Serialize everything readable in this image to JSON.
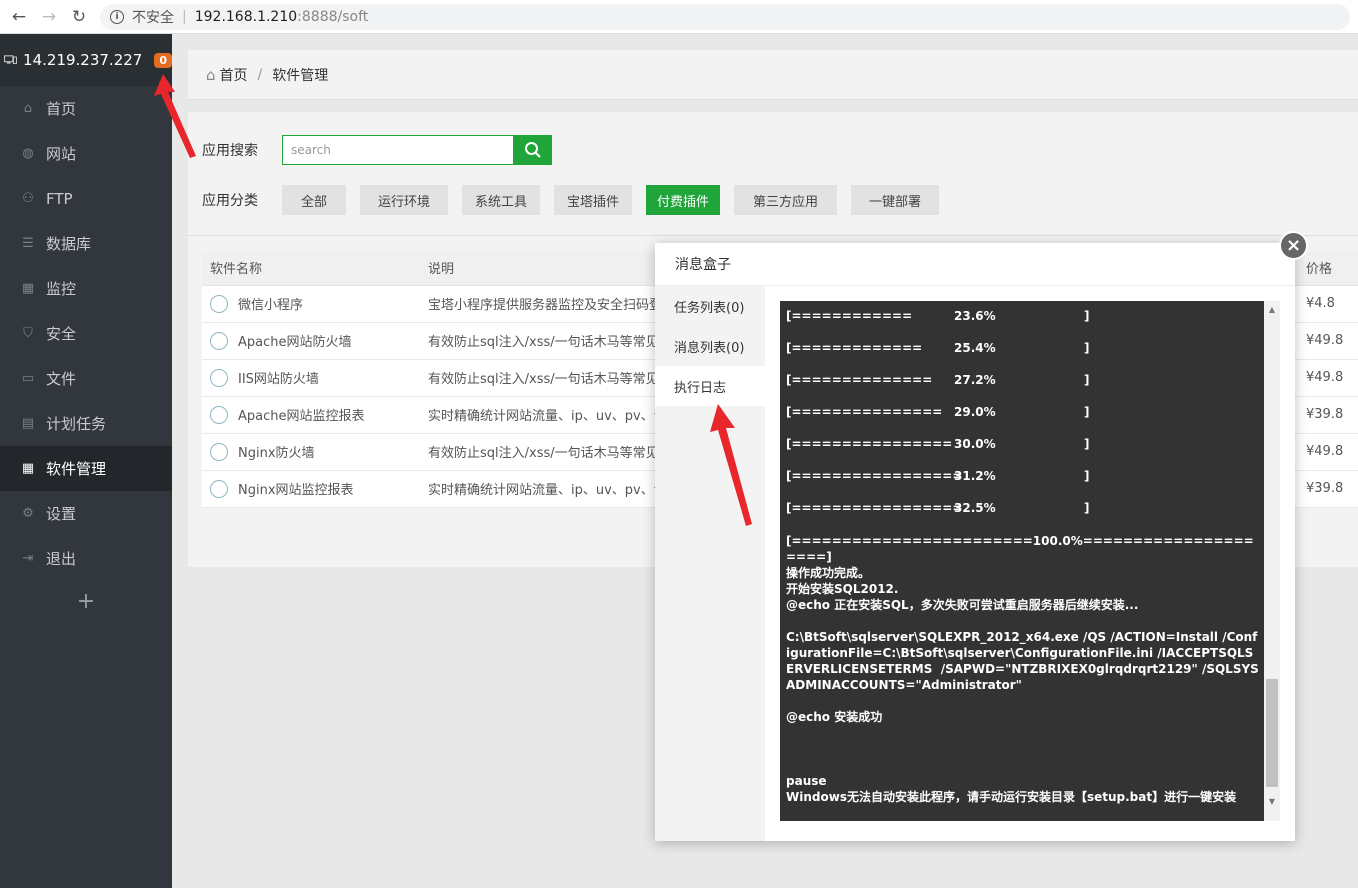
{
  "browser": {
    "insecure_label": "不安全",
    "url_host": "192.168.1.210",
    "url_path": ":8888/soft"
  },
  "sidebar": {
    "server_ip": "14.219.237.227",
    "badge_count": "0",
    "items": [
      {
        "label": "首页",
        "icon": "home-icon"
      },
      {
        "label": "网站",
        "icon": "globe-icon"
      },
      {
        "label": "FTP",
        "icon": "ftp-icon"
      },
      {
        "label": "数据库",
        "icon": "database-icon"
      },
      {
        "label": "监控",
        "icon": "monitor-chart-icon"
      },
      {
        "label": "安全",
        "icon": "shield-icon"
      },
      {
        "label": "文件",
        "icon": "folder-icon"
      },
      {
        "label": "计划任务",
        "icon": "calendar-icon"
      },
      {
        "label": "软件管理",
        "icon": "apps-icon"
      },
      {
        "label": "设置",
        "icon": "gear-icon"
      },
      {
        "label": "退出",
        "icon": "logout-icon"
      }
    ],
    "add_label": "+"
  },
  "breadcrumb": {
    "home": "首页",
    "current": "软件管理"
  },
  "search": {
    "label": "应用搜索",
    "placeholder": "search"
  },
  "categories": {
    "label": "应用分类",
    "items": [
      "全部",
      "运行环境",
      "系统工具",
      "宝塔插件",
      "付费插件",
      "第三方应用",
      "一键部署"
    ]
  },
  "table": {
    "headers": {
      "name": "软件名称",
      "desc": "说明",
      "price": "价格"
    },
    "rows": [
      {
        "name": "微信小程序",
        "desc": "宝塔小程序提供服务器监控及安全扫码登录",
        "price": "¥4.8"
      },
      {
        "name": "Apache网站防火墙",
        "desc": "有效防止sql注入/xss/一句话木马等常见渗",
        "price": "¥49.8"
      },
      {
        "name": "IIS网站防火墙",
        "desc": "有效防止sql注入/xss/一句话木马等常见渗",
        "price": "¥49.8"
      },
      {
        "name": "Apache网站监控报表",
        "desc": "实时精确统计网站流量、ip、uv、pv、请求",
        "price": "¥39.8"
      },
      {
        "name": "Nginx防火墙",
        "desc": "有效防止sql注入/xss/一句话木马等常见渗",
        "price": "¥49.8"
      },
      {
        "name": "Nginx网站监控报表",
        "desc": "实时精确统计网站流量、ip、uv、pv、请求",
        "price": "¥39.8"
      }
    ]
  },
  "dialog": {
    "title": "消息盒子",
    "tabs": [
      "任务列表(0)",
      "消息列表(0)",
      "执行日志"
    ],
    "progress_lines": [
      {
        "bar": "[============",
        "pct": "23.6%",
        "end": "]"
      },
      {
        "bar": "[=============",
        "pct": "25.4%",
        "end": "]"
      },
      {
        "bar": "[==============",
        "pct": "27.2%",
        "end": "]"
      },
      {
        "bar": "[===============",
        "pct": "29.0%",
        "end": "]"
      },
      {
        "bar": "[================",
        "pct": "30.0%",
        "end": "]"
      },
      {
        "bar": "[=================",
        "pct": "31.2%",
        "end": "]"
      },
      {
        "bar": "[=================",
        "pct": "32.5%",
        "end": "]"
      }
    ],
    "log_tail": "[========================100.0%=====================]\n操作成功完成。\n开始安装SQL2012.\n@echo 正在安装SQL，多次失败可尝试重启服务器后继续安装...\n\nC:\\BtSoft\\sqlserver\\SQLEXPR_2012_x64.exe /QS /ACTION=Install /ConfigurationFile=C:\\BtSoft\\sqlserver\\ConfigurationFile.ini /IACCEPTSQLSERVERLICENSETERMS  /SAPWD=\"NTZBRIXEX0glrqdrqrt2129\" /SQLSYSADMINACCOUNTS=\"Administrator\"\n\n@echo 安装成功\n\n\n\npause\nWindows无法自动安装此程序，请手动运行安装目录【setup.bat】进行一键安装"
  }
}
